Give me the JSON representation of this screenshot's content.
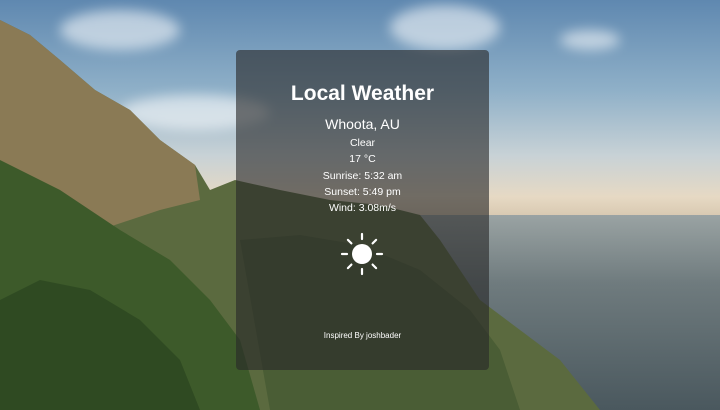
{
  "app": {
    "title": "Local Weather"
  },
  "weather": {
    "location": "Whoota, AU",
    "condition": "Clear",
    "temperature": "17 °C",
    "sunrise": "Sunrise: 5:32 am",
    "sunset": "Sunset: 5:49 pm",
    "wind": "Wind: 3.08m/s",
    "icon": "sun-icon"
  },
  "footer": {
    "credit": "Inspired By joshbader"
  }
}
